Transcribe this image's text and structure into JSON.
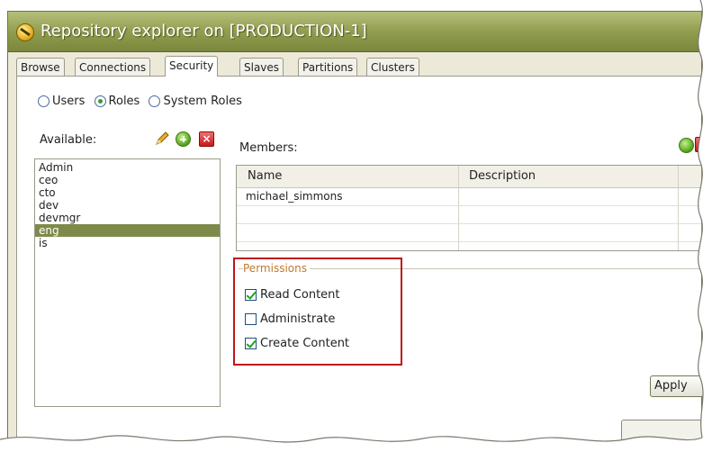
{
  "window": {
    "title": "Repository explorer on [PRODUCTION-1]"
  },
  "tabs": [
    {
      "label": "Browse",
      "active": false
    },
    {
      "label": "Connections",
      "active": false
    },
    {
      "label": "Security",
      "active": true
    },
    {
      "label": "Slaves",
      "active": false
    },
    {
      "label": "Partitions",
      "active": false
    },
    {
      "label": "Clusters",
      "active": false
    }
  ],
  "radios": [
    {
      "label": "Users",
      "checked": false
    },
    {
      "label": "Roles",
      "checked": true
    },
    {
      "label": "System Roles",
      "checked": false
    }
  ],
  "available": {
    "label": "Available:",
    "items": [
      "Admin",
      "ceo",
      "cto",
      "dev",
      "devmgr",
      "eng",
      "is"
    ],
    "selected": "eng"
  },
  "members": {
    "label": "Members:",
    "columns": [
      "Name",
      "Description"
    ],
    "rows": [
      {
        "name": "michael_simmons",
        "description": ""
      }
    ]
  },
  "permissions": {
    "legend": "Permissions",
    "items": [
      {
        "label": "Read Content",
        "checked": true
      },
      {
        "label": "Administrate",
        "checked": false
      },
      {
        "label": "Create Content",
        "checked": true
      }
    ]
  },
  "buttons": {
    "apply": "Apply"
  },
  "icons": {
    "title": "pentaho-logo-icon",
    "edit": "pencil-icon",
    "add": "add-icon",
    "delete": "delete-icon"
  },
  "colors": {
    "titlebar": "#8f9a4c",
    "selection": "#7e8a4a",
    "highlight_box": "#c0151b"
  }
}
